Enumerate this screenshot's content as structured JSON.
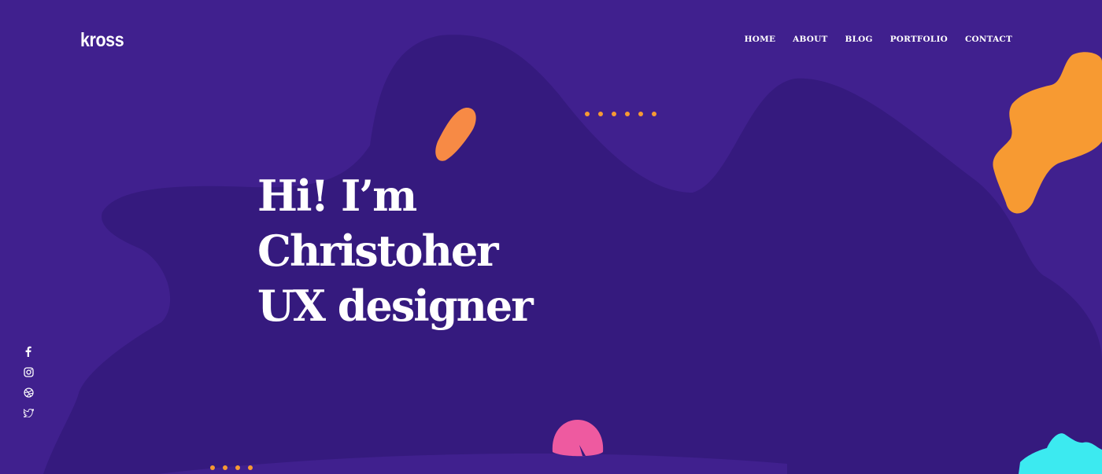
{
  "brand": {
    "logo_text": "kross"
  },
  "nav": {
    "items": [
      {
        "label": "HOME"
      },
      {
        "label": "ABOUT"
      },
      {
        "label": "BLOG"
      },
      {
        "label": "PORTFOLIO"
      },
      {
        "label": "CONTACT"
      }
    ]
  },
  "hero": {
    "lines": [
      "Hi! I’m",
      "Christoher",
      "UX designer"
    ]
  },
  "social": {
    "icons": [
      "facebook-icon",
      "instagram-icon",
      "dribbble-icon",
      "twitter-icon"
    ]
  },
  "colors": {
    "background": "#40208e",
    "blob": "#351a7e",
    "accent_orange": "#f79a32",
    "accent_coral": "#f78a45",
    "accent_pink": "#ee5aa0",
    "accent_cyan": "#3ceaf0",
    "text": "#ffffff"
  }
}
